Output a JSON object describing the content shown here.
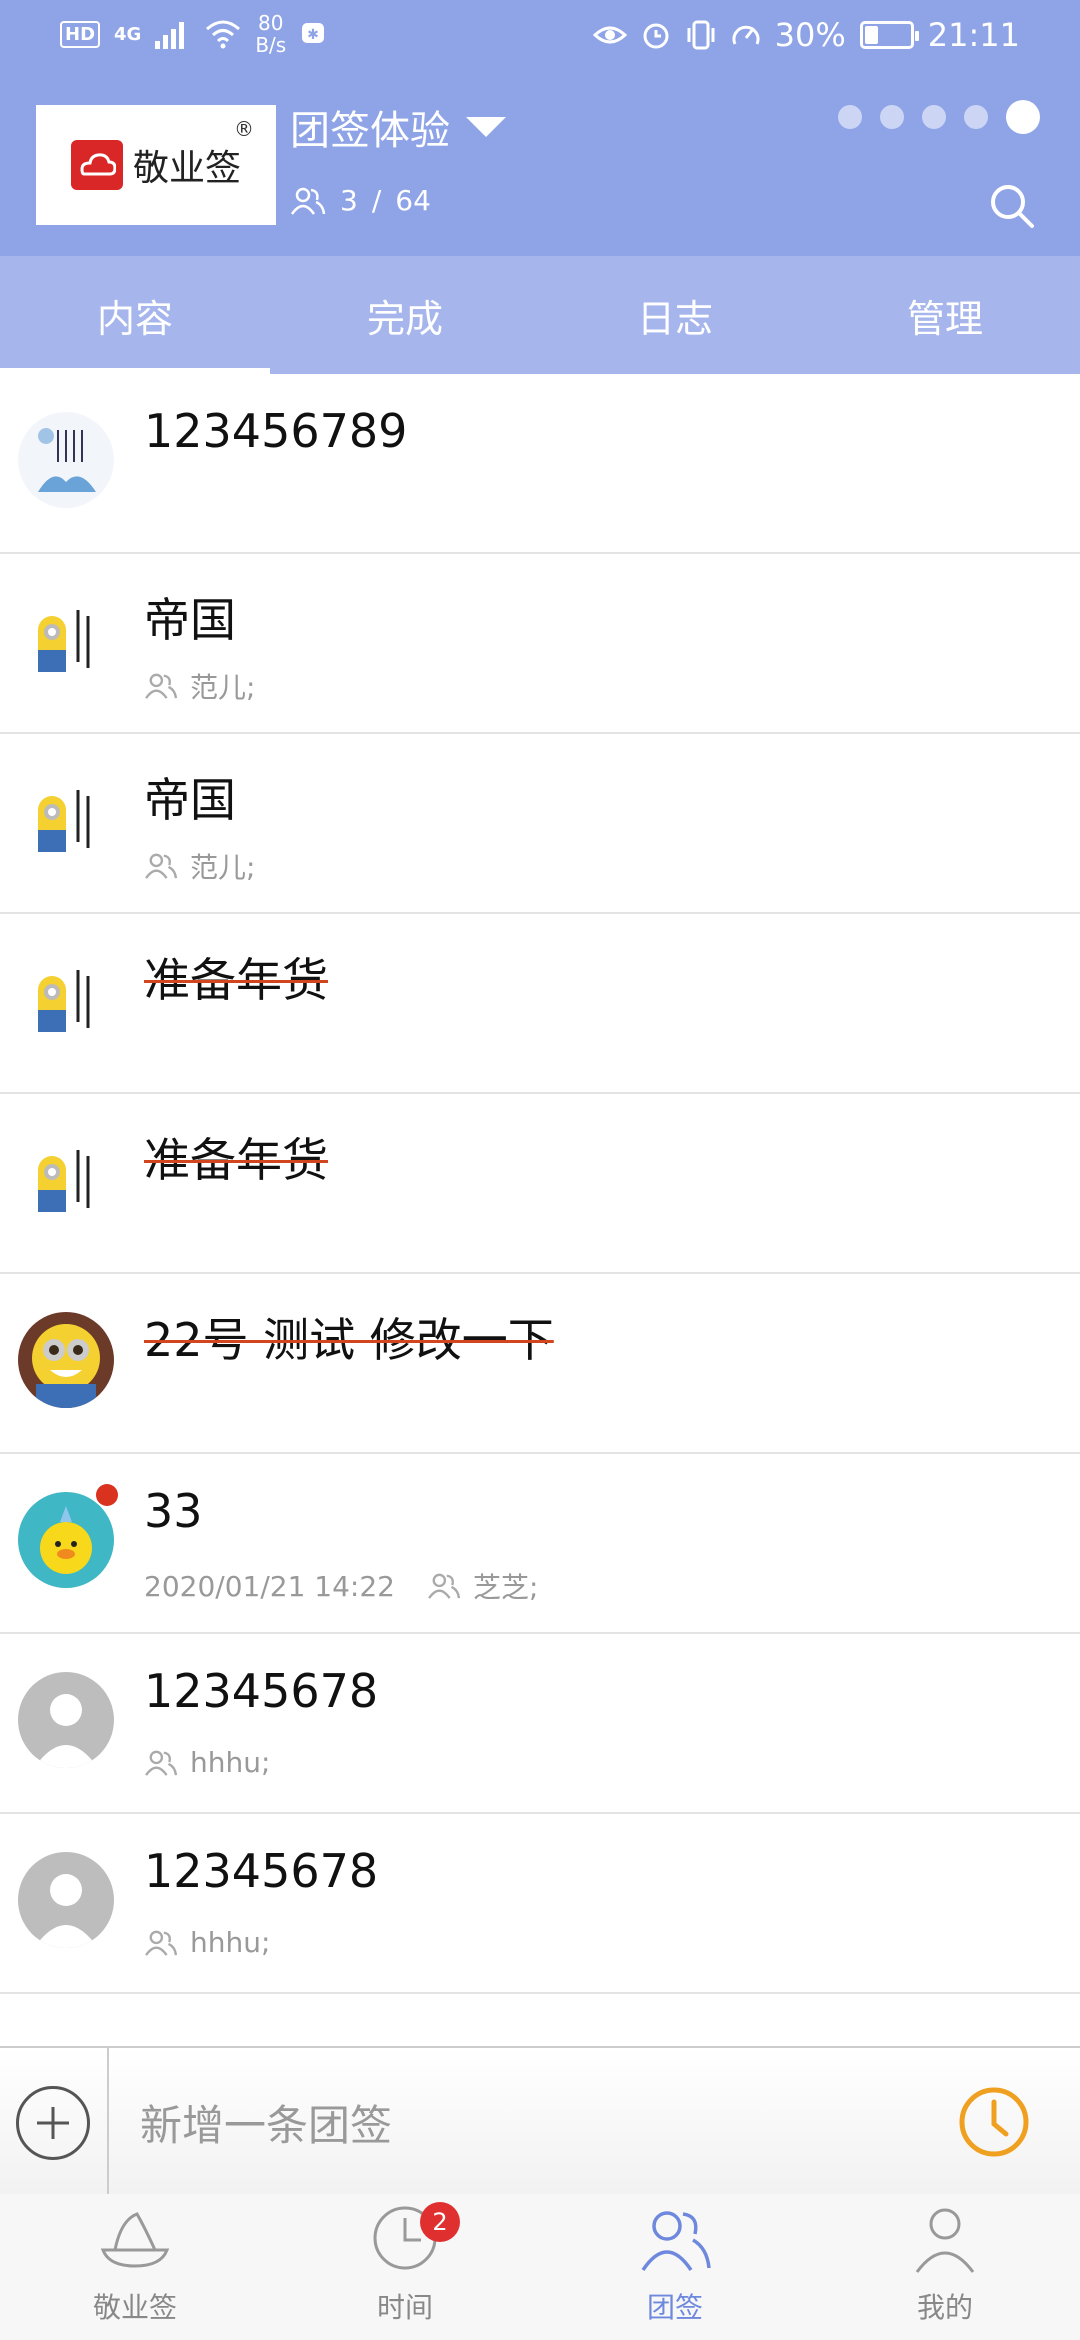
{
  "status_bar": {
    "hd": "HD",
    "network": "4G",
    "speed_value": "80",
    "speed_unit": "B/s",
    "battery_percent": "30%",
    "battery_level": 0.3,
    "time": "21:11"
  },
  "header": {
    "logo_text": "敬业签",
    "logo_reg": "®",
    "team_name": "团签体验",
    "members_online": "3",
    "members_separator": "/",
    "members_total": "64",
    "page_count": 5,
    "active_page": 5
  },
  "tabs": [
    {
      "label": "内容",
      "active": true
    },
    {
      "label": "完成",
      "active": false
    },
    {
      "label": "日志",
      "active": false
    },
    {
      "label": "管理",
      "active": false
    }
  ],
  "items": [
    {
      "title": "123456789",
      "avatar": "poster",
      "meta": "",
      "date": "",
      "strike": false,
      "unread": false
    },
    {
      "title": "帝国",
      "avatar": "minion",
      "meta": "范儿;",
      "date": "",
      "strike": false,
      "unread": false
    },
    {
      "title": "帝国",
      "avatar": "minion",
      "meta": "范儿;",
      "date": "",
      "strike": false,
      "unread": false
    },
    {
      "title": "准备年货",
      "avatar": "minion",
      "meta": "",
      "date": "",
      "strike": true,
      "unread": false
    },
    {
      "title": "准备年货",
      "avatar": "minion",
      "meta": "",
      "date": "",
      "strike": true,
      "unread": false
    },
    {
      "title": "22号 测试  修改一下",
      "avatar": "minion-round",
      "meta": "",
      "date": "",
      "strike": true,
      "unread": false
    },
    {
      "title": "33",
      "avatar": "duck",
      "meta": "芝芝;",
      "date": "2020/01/21 14:22",
      "strike": false,
      "unread": true
    },
    {
      "title": "12345678",
      "avatar": "default",
      "meta": "hhhu;",
      "date": "",
      "strike": false,
      "unread": false
    },
    {
      "title": "12345678",
      "avatar": "default",
      "meta": "hhhu;",
      "date": "",
      "strike": false,
      "unread": false
    }
  ],
  "composer": {
    "placeholder": "新增一条团签"
  },
  "bottom_nav": [
    {
      "label": "敬业签",
      "icon": "boat-icon",
      "active": false,
      "badge": ""
    },
    {
      "label": "时间",
      "icon": "clock-icon",
      "active": false,
      "badge": "2"
    },
    {
      "label": "团签",
      "icon": "team-icon",
      "active": true,
      "badge": ""
    },
    {
      "label": "我的",
      "icon": "person-icon",
      "active": false,
      "badge": ""
    }
  ],
  "colors": {
    "header_bg": "#8fa4e6",
    "tab_bg": "#a6b6ec",
    "strike_line": "#d1451f",
    "accent_orange": "#f0a020",
    "active_nav": "#6e88de",
    "badge_red": "#e02f2f"
  }
}
